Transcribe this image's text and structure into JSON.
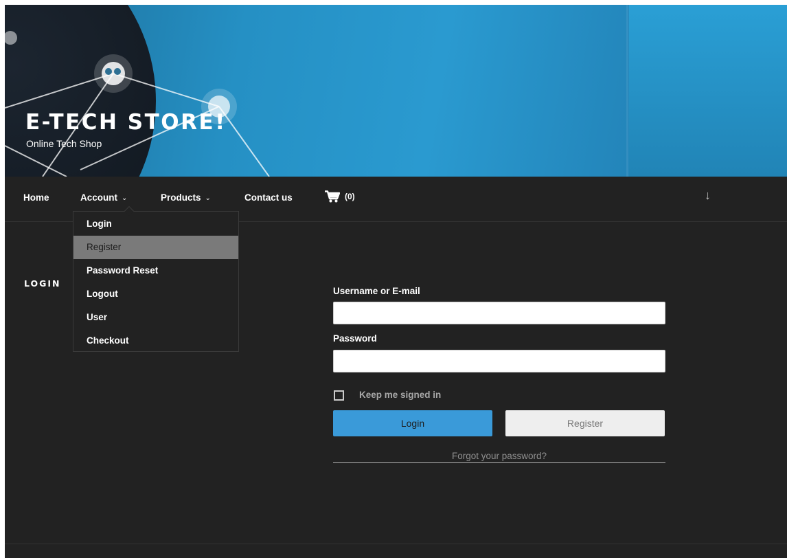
{
  "site": {
    "title": "E-TECH STORE!",
    "tagline": "Online Tech Shop"
  },
  "nav": {
    "home": "Home",
    "account": "Account",
    "products": "Products",
    "contact": "Contact us",
    "cart_count": "(0)",
    "chevron": "⌄",
    "scroll_icon": "↓"
  },
  "account_menu": {
    "items": [
      "Login",
      "Register",
      "Password Reset",
      "Logout",
      "User",
      "Checkout"
    ],
    "highlighted": "Register"
  },
  "page": {
    "heading": "LOGIN"
  },
  "form": {
    "username_label": "Username or E-mail",
    "username_value": "",
    "password_label": "Password",
    "password_value": "",
    "remember_label": "Keep me signed in",
    "remember_checked": false,
    "login_button": "Login",
    "register_button": "Register",
    "forgot_link": "Forgot your password?"
  },
  "colors": {
    "background": "#222222",
    "accent": "#3a9ad9",
    "menu_highlight": "#7a7a7a"
  }
}
